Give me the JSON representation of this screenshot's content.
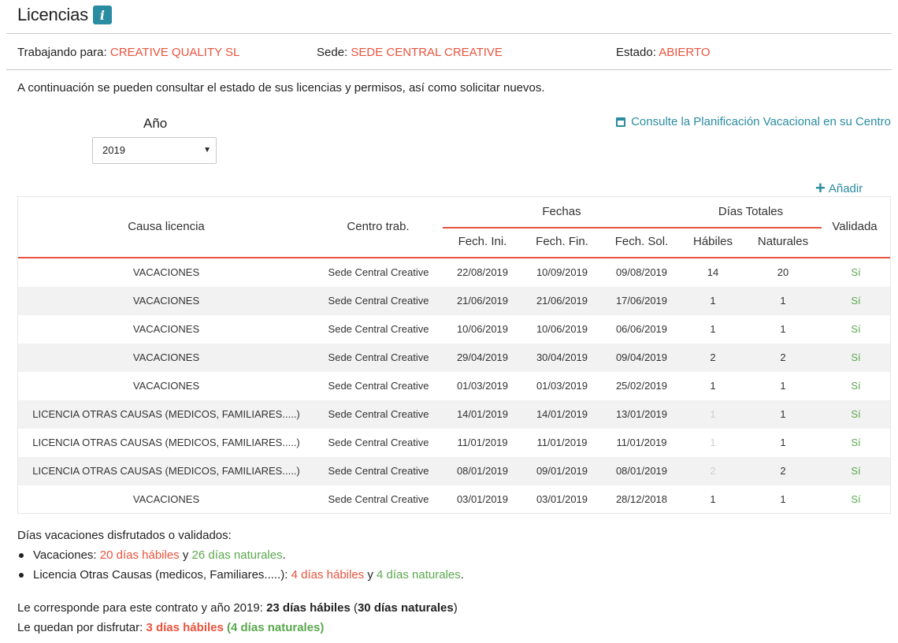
{
  "page": {
    "title": "Licencias",
    "info_icon": "i"
  },
  "meta": {
    "worker_label": "Trabajando para:",
    "worker_value": "CREATIVE QUALITY SL",
    "site_label": "Sede:",
    "site_value": "SEDE CENTRAL CREATIVE",
    "status_label": "Estado:",
    "status_value": "ABIERTO"
  },
  "intro": "A continuación se pueden consultar el estado de sus licencias y permisos, así como solicitar nuevos.",
  "year": {
    "label": "Año",
    "value": "2019"
  },
  "plan_link": "Consulte la Planificación Vacacional en su Centro",
  "add_label": "Añadir",
  "table": {
    "headers": {
      "causa": "Causa licencia",
      "centro": "Centro trab.",
      "fechas": "Fechas",
      "dias": "Días Totales",
      "validada": "Validada",
      "ini": "Fech. Ini.",
      "fin": "Fech. Fin.",
      "sol": "Fech. Sol.",
      "habiles": "Hábiles",
      "naturales": "Naturales"
    },
    "rows": [
      {
        "causa": "VACACIONES",
        "centro": "Sede Central Creative",
        "ini": "22/08/2019",
        "fin": "10/09/2019",
        "sol": "09/08/2019",
        "habiles": "14",
        "naturales": "20",
        "validada": "Sí"
      },
      {
        "causa": "VACACIONES",
        "centro": "Sede Central Creative",
        "ini": "21/06/2019",
        "fin": "21/06/2019",
        "sol": "17/06/2019",
        "habiles": "1",
        "naturales": "1",
        "validada": "Sí"
      },
      {
        "causa": "VACACIONES",
        "centro": "Sede Central Creative",
        "ini": "10/06/2019",
        "fin": "10/06/2019",
        "sol": "06/06/2019",
        "habiles": "1",
        "naturales": "1",
        "validada": "Sí"
      },
      {
        "causa": "VACACIONES",
        "centro": "Sede Central Creative",
        "ini": "29/04/2019",
        "fin": "30/04/2019",
        "sol": "09/04/2019",
        "habiles": "2",
        "naturales": "2",
        "validada": "Sí"
      },
      {
        "causa": "VACACIONES",
        "centro": "Sede Central Creative",
        "ini": "01/03/2019",
        "fin": "01/03/2019",
        "sol": "25/02/2019",
        "habiles": "1",
        "naturales": "1",
        "validada": "Sí"
      },
      {
        "causa": "LICENCIA OTRAS CAUSAS (MEDICOS, FAMILIARES.....)",
        "centro": "Sede Central Creative",
        "ini": "14/01/2019",
        "fin": "14/01/2019",
        "sol": "13/01/2019",
        "habiles": "1",
        "naturales": "1",
        "validada": "Sí",
        "habiles_muted": true
      },
      {
        "causa": "LICENCIA OTRAS CAUSAS (MEDICOS, FAMILIARES.....)",
        "centro": "Sede Central Creative",
        "ini": "11/01/2019",
        "fin": "11/01/2019",
        "sol": "11/01/2019",
        "habiles": "1",
        "naturales": "1",
        "validada": "Sí",
        "habiles_muted": true
      },
      {
        "causa": "LICENCIA OTRAS CAUSAS (MEDICOS, FAMILIARES.....)",
        "centro": "Sede Central Creative",
        "ini": "08/01/2019",
        "fin": "09/01/2019",
        "sol": "08/01/2019",
        "habiles": "2",
        "naturales": "2",
        "validada": "Sí",
        "habiles_muted": true
      },
      {
        "causa": "VACACIONES",
        "centro": "Sede Central Creative",
        "ini": "03/01/2019",
        "fin": "03/01/2019",
        "sol": "28/12/2018",
        "habiles": "1",
        "naturales": "1",
        "validada": "Sí"
      }
    ]
  },
  "summary": {
    "heading": "Días vacaciones disfrutados o validados:",
    "vac_label": "Vacaciones: ",
    "vac_habiles": "20 días hábiles",
    "vac_y": " y ",
    "vac_naturales": "26 días naturales",
    "vac_end": ".",
    "lic_label": "Licencia Otras Causas (medicos, Familiares.....): ",
    "lic_habiles": "4 días hábiles",
    "lic_y": " y ",
    "lic_naturales": "4 días naturales",
    "lic_end": ".",
    "contract_text": "Le corresponde para este contrato y año 2019: ",
    "contract_habiles": "23 días hábiles",
    "contract_naturales_open": " (",
    "contract_naturales": "30 días naturales",
    "contract_naturales_close": ")",
    "remaining_text": "Le quedan por disfrutar: ",
    "remaining_habiles": "3 días hábiles",
    "remaining_naturales": " (4 días naturales)"
  },
  "colors": {
    "accent": "#e8533d",
    "link": "#2a8ca0",
    "positive": "#5ba84e"
  }
}
